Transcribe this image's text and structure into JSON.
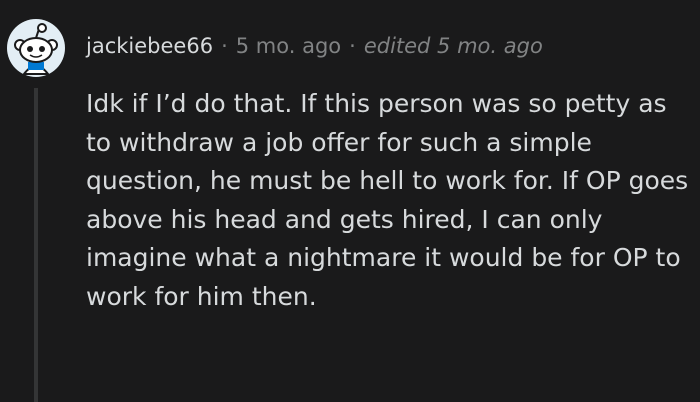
{
  "comment": {
    "username": "jackiebee66",
    "time": "5 mo. ago",
    "edited": "edited 5 mo. ago",
    "separator": "·",
    "body": "Idk if I’d do that. If this person was so petty as to withdraw a job offer for such a simple question, he must be hell to work for. If OP goes above his head and gets hired, I can only imagine what a nightmare it would be for OP to work for him then."
  },
  "colors": {
    "background": "#1a1a1b",
    "text": "#d7dadc",
    "meta": "#818384",
    "avatar_bg": "#e3eef5",
    "avatar_accent": "#0079d3",
    "thread_line": "#343536"
  },
  "icons": {
    "avatar": "snoo-avatar-icon"
  }
}
